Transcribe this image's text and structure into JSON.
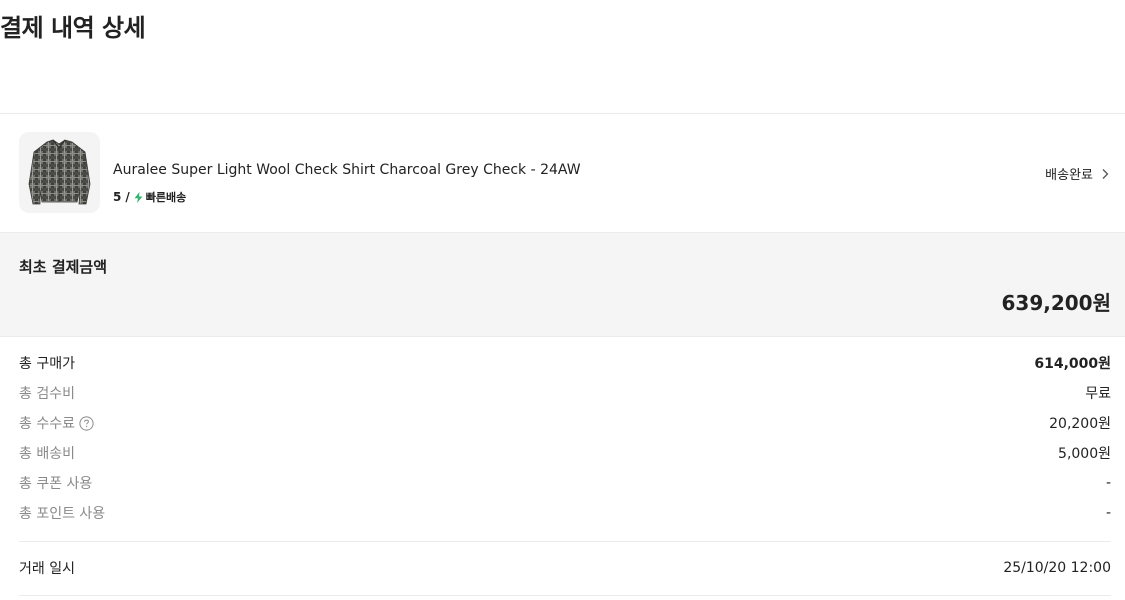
{
  "page": {
    "title": "결제 내역 상세"
  },
  "product": {
    "name": "Auralee Super Light Wool Check Shirt Charcoal Grey Check - 24AW",
    "size": "5",
    "separator": "/",
    "shipping_label": "빠른배송",
    "shipping_icon": "lightning-bolt-icon",
    "status_label": "배송완료",
    "status_icon": "chevron-right-icon"
  },
  "initial_payment": {
    "label": "최초 결제금액",
    "amount": "639,200원"
  },
  "fees": [
    {
      "label": "총 구매가",
      "value": "614,000원"
    },
    {
      "label": "총 검수비",
      "value": "무료"
    },
    {
      "label": "총 수수료",
      "value": "20,200원"
    },
    {
      "label": "총 배송비",
      "value": "5,000원"
    },
    {
      "label": "총 쿠폰 사용",
      "value": "-"
    },
    {
      "label": "총 포인트 사용",
      "value": "-"
    }
  ],
  "transaction": {
    "label": "거래 일시",
    "value": "25/10/20 12:00"
  },
  "colors": {
    "text_primary": "#222222",
    "text_secondary": "#8a8a8a",
    "fast_shipping": "#31b46e",
    "box_background": "#f5f5f5",
    "divider": "#ebebeb"
  }
}
